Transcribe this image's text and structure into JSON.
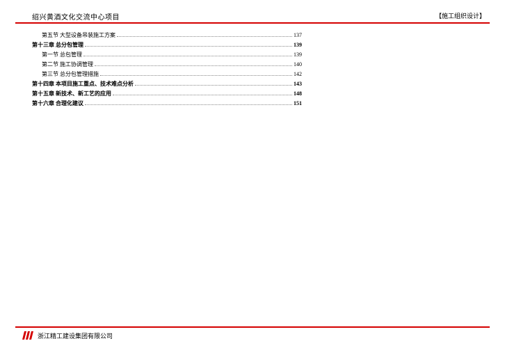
{
  "header": {
    "left": "绍兴黄酒文化交流中心项目",
    "right": "【施工组织设计】"
  },
  "toc": [
    {
      "label": "第五节  大型设备吊装施工方案",
      "page": "137",
      "indent": 1,
      "bold": false
    },
    {
      "label": "第十三章  总分包管理",
      "page": "139",
      "indent": 0,
      "bold": true
    },
    {
      "label": "第一节  总包管理",
      "page": "139",
      "indent": 1,
      "bold": false
    },
    {
      "label": "第二节  施工协调管理",
      "page": "140",
      "indent": 1,
      "bold": false
    },
    {
      "label": "第三节  总分包管理措施",
      "page": "142",
      "indent": 1,
      "bold": false
    },
    {
      "label": "第十四章  本项目施工重点、技术难点分析",
      "page": "143",
      "indent": 0,
      "bold": true
    },
    {
      "label": "第十五章  新技术、新工艺的应用",
      "page": "148",
      "indent": 0,
      "bold": true
    },
    {
      "label": "第十六章  合理化建议",
      "page": "151",
      "indent": 0,
      "bold": true
    }
  ],
  "footer": {
    "company": "浙江精工建设集团有限公司"
  }
}
